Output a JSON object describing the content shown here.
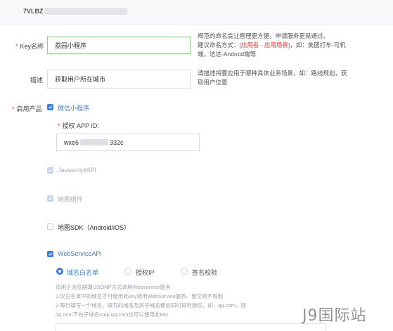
{
  "header": {
    "key_prefix": "7VLBZ"
  },
  "form": {
    "key_name": {
      "required": "*",
      "label": "Key名称",
      "value": "荔园小程序",
      "help_line1": "规范的命名会让管理更方便，申请服务更易通过。",
      "help_line2_prefix": "建议命名方式：",
      "help_line2_red": "[应用名 - 应用场景]",
      "help_line2_suffix": "，如：美团打车-司机",
      "help_line3": "端，达达-Android端等"
    },
    "description": {
      "label": "描述",
      "value": "获取用户所在城市",
      "help_line1": "请描述将要应用于哪种具体业务场景，如：路线规划，获",
      "help_line2": "取用户位置"
    },
    "products": {
      "required": "*",
      "label": "启用产品",
      "mini_program": "微信小程序",
      "app_id": {
        "required": "*",
        "label": "授权 APP ID:",
        "value_prefix": "wxe6",
        "value_suffix": "332c"
      },
      "javascript_api": "JavascriptAPI",
      "map_component": "地图组件",
      "map_sdk": "地图SDK（Android/iOS）",
      "webservice_api": "WebServiceAPI",
      "radios": {
        "domain_whitelist": "域名白名单",
        "authorized_ip": "授权IP",
        "signature": "签名校验"
      },
      "notes": [
        "适用于浏览器端/JSONP方式调用Webservice服务",
        "1.仅白名单中的域名才可使用此key调用WebService服务，留空则不限制",
        "2.每行填写一个域名，填写的域名及其子域名都会同时得到授权，如：qq.com，则",
        "qq.com下的子域名map.qq.com也可以使用此key"
      ]
    }
  },
  "watermark": "J9国际站",
  "colors": {
    "accent": "#3d7fe0",
    "required": "#e33333",
    "focus_border": "#8fcf86"
  }
}
